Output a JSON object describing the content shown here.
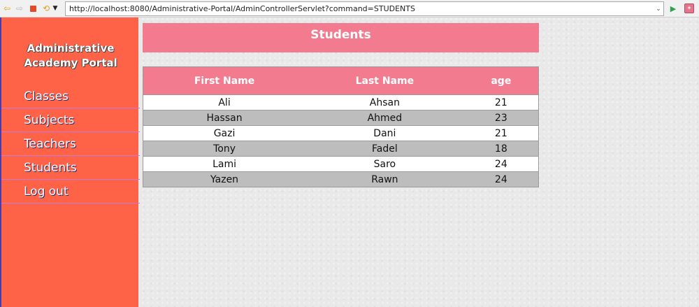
{
  "browser": {
    "url": "http://localhost:8080/Administrative-Portal/AdminControllerServlet?command=STUDENTS",
    "icons": [
      "back-arrow-icon",
      "forward-arrow-icon",
      "stop-icon",
      "refresh-icon",
      "menu-dropdown-icon",
      "go-icon",
      "extension-icon"
    ]
  },
  "sidebar": {
    "brand_line1": "Administrative",
    "brand_line2": "Academy Portal",
    "items": [
      {
        "label": "Classes"
      },
      {
        "label": "Subjects"
      },
      {
        "label": "Teachers"
      },
      {
        "label": "Students"
      },
      {
        "label": "Log out"
      }
    ]
  },
  "main": {
    "title": "Students",
    "table": {
      "headers": [
        "First Name",
        "Last Name",
        "age"
      ],
      "rows": [
        [
          "Ali",
          "Ahsan",
          "21"
        ],
        [
          "Hassan",
          "Ahmed",
          "23"
        ],
        [
          "Gazi",
          "Dani",
          "21"
        ],
        [
          "Tony",
          "Fadel",
          "18"
        ],
        [
          "Lami",
          "Saro",
          "24"
        ],
        [
          "Yazen",
          "Rawn",
          "24"
        ]
      ]
    }
  },
  "colors": {
    "sidebar_bg": "#ff6347",
    "header_bg": "#f27b8f",
    "row_alt_bg": "#bdbdbd"
  }
}
